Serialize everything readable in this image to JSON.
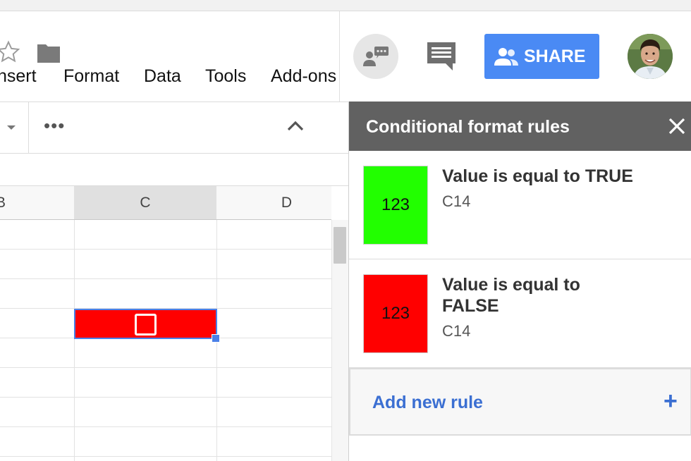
{
  "menu": {
    "items": [
      "nsert",
      "Format",
      "Data",
      "Tools",
      "Add-ons"
    ]
  },
  "icons": {
    "star": "star-outline-icon",
    "folder": "folder-icon",
    "chat": "chat-icon",
    "comments": "comment-icon",
    "share_people": "people-icon",
    "close": "close-icon",
    "more": "more-horiz-icon",
    "collapse": "chevron-up-icon",
    "dropdown": "caret-down-icon"
  },
  "toolbar": {
    "more": "•••"
  },
  "grid": {
    "columns": [
      "B",
      "C",
      "D"
    ],
    "selected_column": "C",
    "selected_cell_fill": "#ff0000",
    "checkbox_checked": false
  },
  "header": {
    "share_label": "SHARE",
    "share_color": "#4a8af4"
  },
  "panel": {
    "title": "Conditional format rules",
    "rules": [
      {
        "preview": "123",
        "description": "Value is equal to TRUE",
        "range": "C14",
        "color": "#22ff00"
      },
      {
        "preview": "123",
        "description_lines": [
          "Value is equal to",
          "FALSE"
        ],
        "range": "C14",
        "color": "#ff0000"
      }
    ],
    "add_label": "Add new rule",
    "add_icon": "+"
  }
}
